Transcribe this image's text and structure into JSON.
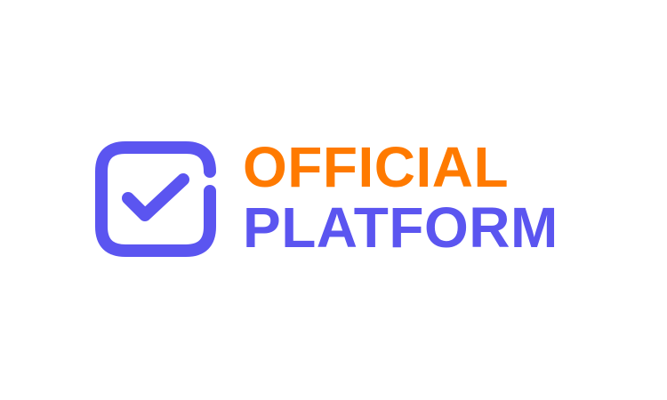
{
  "logo": {
    "mark_icon": "rounded-checkbox-check-icon",
    "wordmark": {
      "line1": "OFFICIAL",
      "line2": "PLATFORM"
    },
    "colors": {
      "primary": "#5b55f0",
      "accent": "#ff7a00",
      "background": "#ffffff"
    }
  }
}
